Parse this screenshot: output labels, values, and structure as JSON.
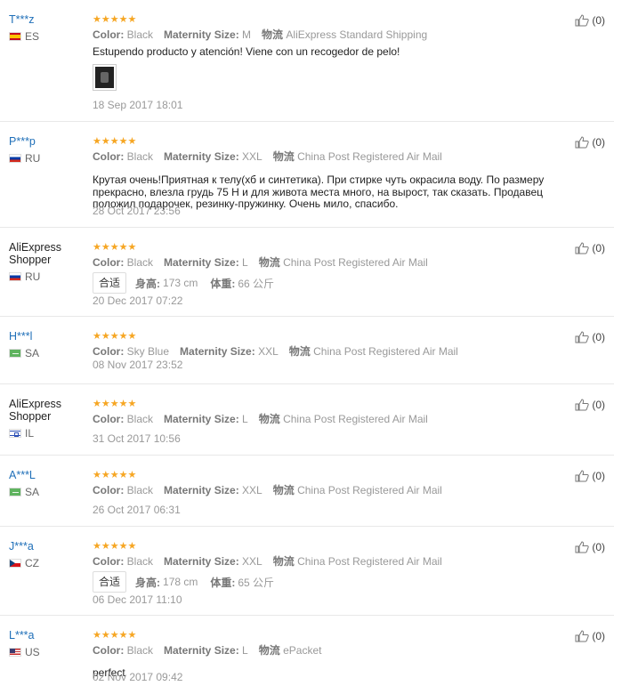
{
  "labels": {
    "color": "Color:",
    "maternity_size": "Maternity Size:",
    "logistics": "物流",
    "height": "身高:",
    "weight": "体重:"
  },
  "colors": {
    "stars": "#f6a623",
    "username": "#1f6fb8"
  },
  "icons": {
    "rating": "star-icon",
    "helpful": "thumbs-up-icon",
    "flag": "flag-icon"
  },
  "reviews": [
    {
      "user": "T***z",
      "country": "ES",
      "rating": 5,
      "color": "Black",
      "size": "M",
      "shipping": "AliExpress Standard Shipping",
      "text": "Estupendo producto y atención! Viene con un recogedor de pelo!",
      "has_photo": true,
      "date": "18 Sep 2017 18:01",
      "helpful": "(0)"
    },
    {
      "user": "P***p",
      "country": "RU",
      "rating": 5,
      "color": "Black",
      "size": "XXL",
      "shipping": "China Post Registered Air Mail",
      "text": "Крутая очень!Приятная к телу(хб и синтетика). При стирке чуть окрасила воду. По размеру прекрасно, влезла грудь 75 Н и для живота места много, на вырост, так сказать. Продавец положил подарочек, резинку-пружинку. Очень мило, спасибо.",
      "date": "28 Oct 2017 23:56",
      "helpful": "(0)"
    },
    {
      "user": "AliExpress Shopper",
      "country": "RU",
      "rating": 5,
      "color": "Black",
      "size": "L",
      "shipping": "China Post Registered Air Mail",
      "fit": "合适",
      "height": "173 cm",
      "weight": "66 公斤",
      "date": "20 Dec 2017 07:22",
      "helpful": "(0)"
    },
    {
      "user": "H***l",
      "country": "SA",
      "rating": 5,
      "color": "Sky Blue",
      "size": "XXL",
      "shipping": "China Post Registered Air Mail",
      "date": "08 Nov 2017 23:52",
      "helpful": "(0)"
    },
    {
      "user": "AliExpress Shopper",
      "country": "IL",
      "rating": 5,
      "color": "Black",
      "size": "L",
      "shipping": "China Post Registered Air Mail",
      "date": "31 Oct 2017 10:56",
      "helpful": "(0)"
    },
    {
      "user": "A***L",
      "country": "SA",
      "rating": 5,
      "color": "Black",
      "size": "XXL",
      "shipping": "China Post Registered Air Mail",
      "date": "26 Oct 2017 06:31",
      "helpful": "(0)"
    },
    {
      "user": "J***a",
      "country": "CZ",
      "rating": 5,
      "color": "Black",
      "size": "XXL",
      "shipping": "China Post Registered Air Mail",
      "fit": "合适",
      "height": "178 cm",
      "weight": "65 公斤",
      "date": "06 Dec 2017 11:10",
      "helpful": "(0)"
    },
    {
      "user": "L***a",
      "country": "US",
      "rating": 5,
      "color": "Black",
      "size": "L",
      "shipping": "ePacket",
      "text": "perfect",
      "date": "02 Nov 2017 09:42",
      "helpful": "(0)"
    }
  ]
}
